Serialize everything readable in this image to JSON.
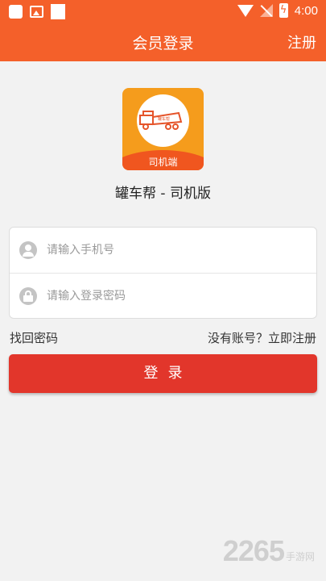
{
  "status_bar": {
    "time": "4:00"
  },
  "nav": {
    "title": "会员登录",
    "register": "注册"
  },
  "logo": {
    "badge_text": "司机端",
    "truck_label": "罐车帮"
  },
  "app_name": "罐车帮 - 司机版",
  "form": {
    "phone_placeholder": "请输入手机号",
    "password_placeholder": "请输入登录密码"
  },
  "links": {
    "forgot": "找回密码",
    "signup": "没有账号？立即注册"
  },
  "login_button": "登录",
  "watermark": {
    "number": "2265",
    "text": "手游网"
  },
  "colors": {
    "brand": "#f4602a",
    "button": "#e2362b",
    "logo_bg": "#f59c1c"
  }
}
